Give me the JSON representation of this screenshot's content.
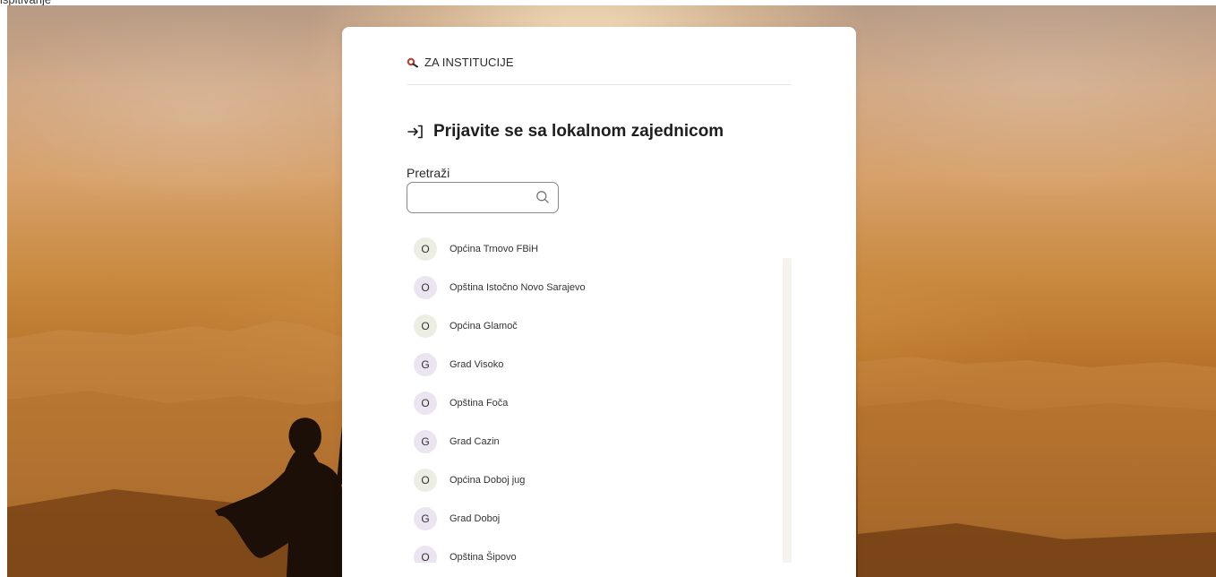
{
  "header": {
    "top_text": "ispitivanje"
  },
  "card": {
    "institutions_label": "ZA INSTITUCIJE",
    "title": "Prijavite se sa lokalnom zajednicom",
    "search_label": "Pretraži",
    "search_value": "",
    "search_placeholder": ""
  },
  "communities": [
    {
      "initial": "O",
      "name": "Općina Trnovo FBiH",
      "color": "#eceee4"
    },
    {
      "initial": "O",
      "name": "Opština Istočno Novo Sarajevo",
      "color": "#ebe4f1"
    },
    {
      "initial": "O",
      "name": "Općina Glamoč",
      "color": "#eceee4"
    },
    {
      "initial": "G",
      "name": "Grad Visoko",
      "color": "#ebe4f1"
    },
    {
      "initial": "O",
      "name": "Opština Foča",
      "color": "#ebe4f1"
    },
    {
      "initial": "G",
      "name": "Grad Cazin",
      "color": "#ebe4f1"
    },
    {
      "initial": "O",
      "name": "Općina Doboj jug",
      "color": "#eceee4"
    },
    {
      "initial": "G",
      "name": "Grad Doboj",
      "color": "#ebe4f1"
    },
    {
      "initial": "O",
      "name": "Opština Šipovo",
      "color": "#ebe4f1"
    }
  ],
  "icons": {
    "institutions": "search-key-icon",
    "login": "login-arrow-icon",
    "search": "search-icon"
  }
}
